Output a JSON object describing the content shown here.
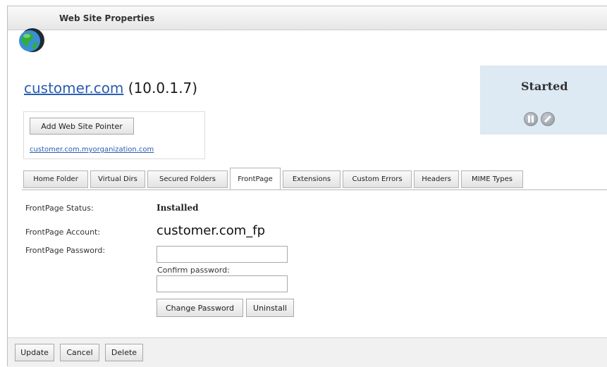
{
  "window": {
    "title": "Web Site Properties"
  },
  "site": {
    "name": "customer.com",
    "ip": "(10.0.1.7)",
    "add_pointer_label": "Add Web Site Pointer",
    "pointer_link": "customer.com.myorganization.com"
  },
  "status": {
    "text": "Started",
    "controls": [
      "pause-icon",
      "stop-icon"
    ]
  },
  "tabs": {
    "items": [
      "Home Folder",
      "Virtual Dirs",
      "Secured Folders",
      "FrontPage",
      "Extensions",
      "Custom Errors",
      "Headers",
      "MIME Types"
    ],
    "active": "FrontPage"
  },
  "frontpage": {
    "status_label": "FrontPage Status:",
    "status_value": "Installed",
    "account_label": "FrontPage Account:",
    "account_value": "customer.com_fp",
    "password_label": "FrontPage Password:",
    "password_value": "",
    "confirm_label": "Confirm password:",
    "confirm_value": "",
    "change_password_label": "Change Password",
    "uninstall_label": "Uninstall"
  },
  "footer": {
    "update_label": "Update",
    "cancel_label": "Cancel",
    "delete_label": "Delete"
  },
  "colors": {
    "link": "#2a5db0",
    "status_panel": "#dde9f3",
    "globe_green": "#2fae3a",
    "globe_blue": "#3a8fd4"
  }
}
